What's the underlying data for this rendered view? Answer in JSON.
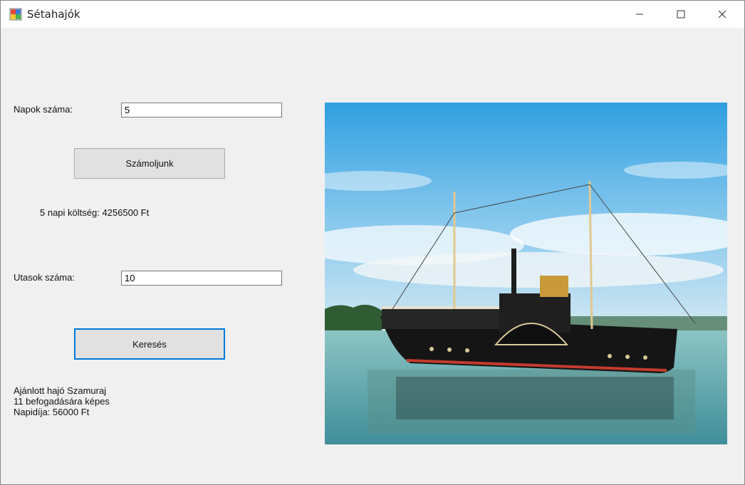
{
  "window": {
    "title": "Sétahajók",
    "controls": {
      "minimize": "minimize-icon",
      "maximize": "maximize-icon",
      "close": "close-icon"
    }
  },
  "form": {
    "days_label": "Napok száma:",
    "days_value": "5",
    "calculate_button": "Számoljunk",
    "cost_result": "5 napi költség: 4256500 Ft",
    "passengers_label": "Utasok száma:",
    "passengers_value": "10",
    "search_button": "Keresés",
    "recommendation": {
      "line1": "Ajánlott hajó Szamuraj",
      "line2": "11 befogadására képes",
      "line3": "Napidíja: 56000 Ft"
    }
  },
  "picture": {
    "subject": "paddle-steamer-ship-on-lake"
  },
  "colors": {
    "accent": "#0078d7",
    "window_bg": "#f0f0f0",
    "button_bg": "#e1e1e1"
  }
}
